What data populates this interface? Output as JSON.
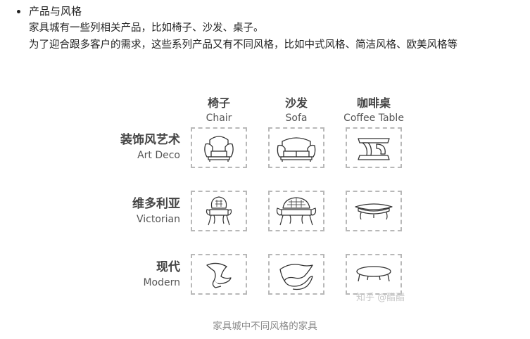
{
  "bullet": {
    "title": "产品与风格",
    "line1": "家具城有一些列相关产品，比如椅子、沙发、桌子。",
    "line2": "为了迎合跟多客户的需求，这些系列产品又有不同风格，比如中式风格、简洁风格、欧美风格等"
  },
  "figure": {
    "columns": [
      {
        "zh": "椅子",
        "en": "Chair"
      },
      {
        "zh": "沙发",
        "en": "Sofa"
      },
      {
        "zh": "咖啡桌",
        "en": "Coffee Table"
      }
    ],
    "rows": [
      {
        "zh": "装饰风艺术",
        "en": "Art Deco"
      },
      {
        "zh": "维多利亚",
        "en": "Victorian"
      },
      {
        "zh": "现代",
        "en": "Modern"
      }
    ],
    "cells": [
      [
        "art-deco-chair-icon",
        "art-deco-sofa-icon",
        "art-deco-coffee-table-icon"
      ],
      [
        "victorian-chair-icon",
        "victorian-sofa-icon",
        "victorian-coffee-table-icon"
      ],
      [
        "modern-chair-icon",
        "modern-sofa-icon",
        "modern-coffee-table-icon"
      ]
    ],
    "watermark": "知乎 @醋醋",
    "caption": "家具城中不同风格的家具"
  }
}
